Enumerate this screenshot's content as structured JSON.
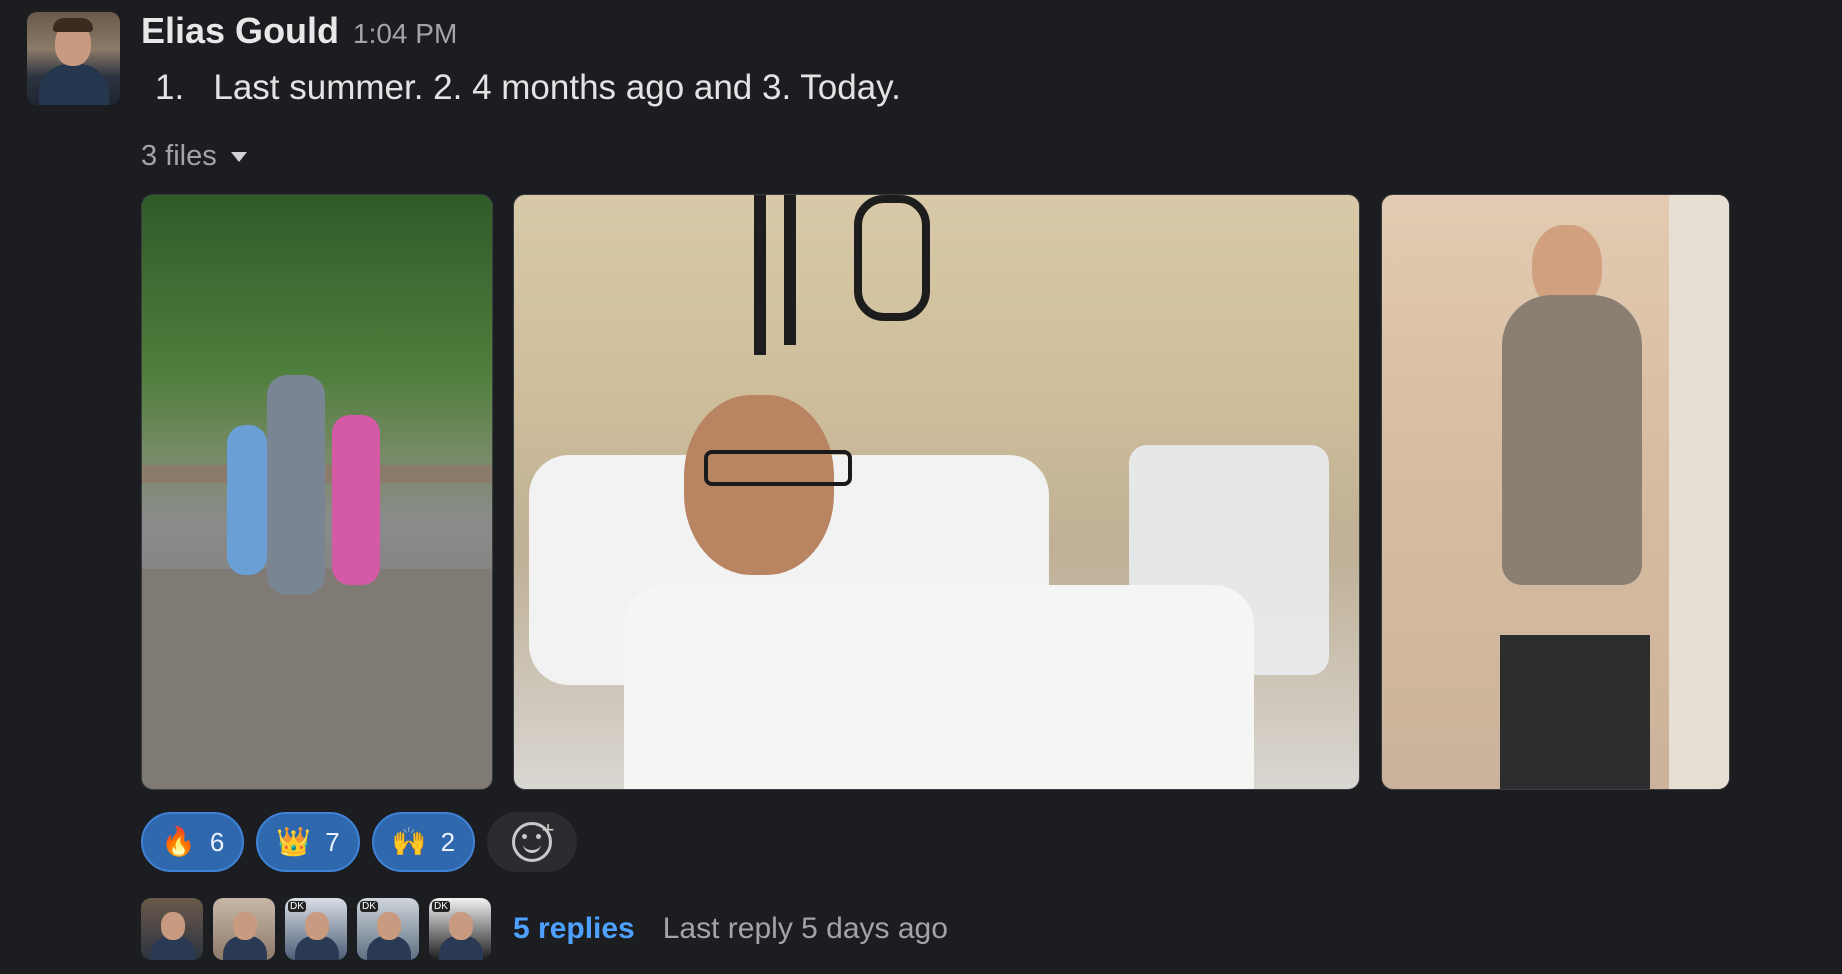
{
  "message": {
    "author": "Elias Gould",
    "timestamp": "1:04 PM",
    "text": "1.   Last summer. 2. 4 months ago and 3. Today."
  },
  "files": {
    "label": "3 files",
    "items": [
      {
        "name": "image-1",
        "description": "Last summer"
      },
      {
        "name": "image-2",
        "description": "4 months ago"
      },
      {
        "name": "image-3",
        "description": "Today"
      }
    ]
  },
  "reactions": [
    {
      "emoji": "🔥",
      "count": "6"
    },
    {
      "emoji": "👑",
      "count": "7"
    },
    {
      "emoji": "🙌",
      "count": "2"
    }
  ],
  "add_reaction_icon": "add-reaction-icon",
  "thread": {
    "replies_label": "5 replies",
    "last_reply": "Last reply 5 days ago",
    "avatars": [
      {
        "tag": ""
      },
      {
        "tag": ""
      },
      {
        "tag": "DK"
      },
      {
        "tag": "DK"
      },
      {
        "tag": "DK"
      }
    ]
  },
  "colors": {
    "background": "#1b1d21",
    "reaction_bg": "#2f68ad",
    "reply_link": "#4ea1ff"
  }
}
